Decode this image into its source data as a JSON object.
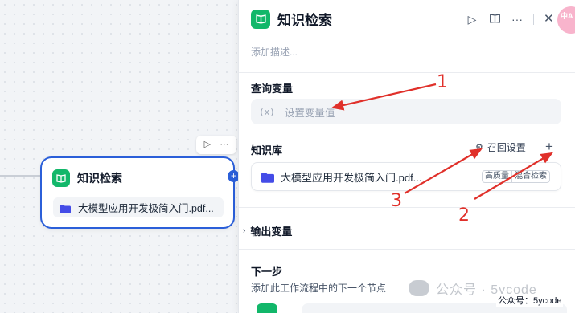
{
  "node": {
    "title": "知识检索",
    "file_name": "大模型应用开发极简入门.pdf...",
    "toolbar_run_icon": "play-icon",
    "toolbar_more_icon": "more-icon"
  },
  "panel": {
    "title": "知识检索",
    "description_placeholder": "添加描述...",
    "query_section_label": "查询变量",
    "query_var_prefix": "(x)",
    "query_var_placeholder": "设置变量值",
    "kb_section_label": "知识库",
    "recall_settings_label": "召回设置",
    "kb_file_name": "大模型应用开发极简入门.pdf...",
    "badge_quality": "高质量",
    "badge_mixed": "混合检索",
    "output_section_label": "输出变量",
    "next_section_label": "下一步",
    "next_section_desc": "添加此工作流程中的下一个节点"
  },
  "annotations": {
    "n1": "1",
    "n2": "2",
    "n3": "3"
  },
  "watermark": {
    "text": "公众号 · 5ycode",
    "footer": "公众号：5ycode"
  },
  "avatar_text": "中A",
  "colors": {
    "accent": "#2b5fd9",
    "app_icon": "#12b76a",
    "annotation": "#e0302a"
  }
}
